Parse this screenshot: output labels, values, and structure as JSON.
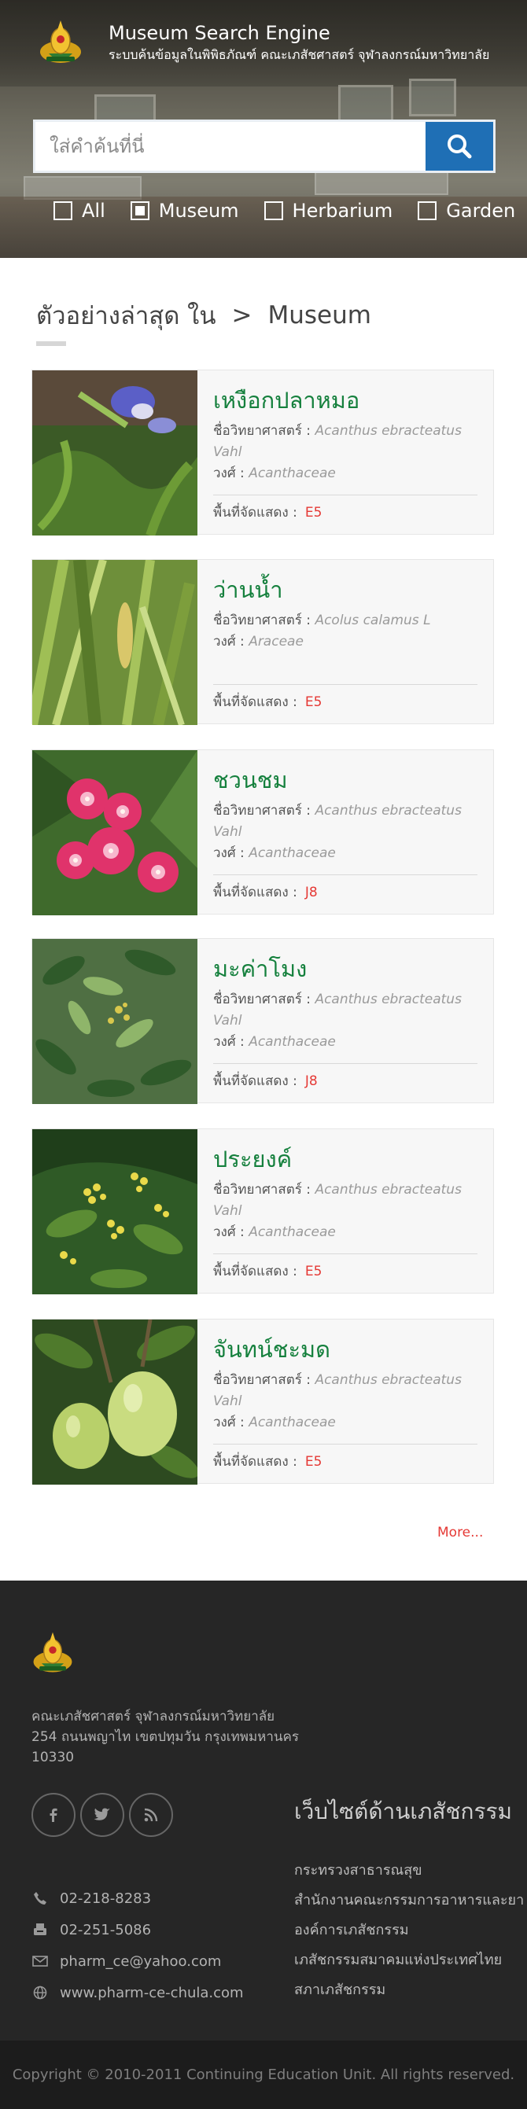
{
  "header": {
    "title": "Museum Search Engine",
    "subtitle": "ระบบค้นข้อมูลในพิพิธภัณฑ์ คณะเภสัชศาสตร์ จุฬาลงกรณ์มหาวิทยาลัย"
  },
  "search": {
    "placeholder": "ใส่คำค้นที่นี่",
    "value": "",
    "button_icon": "search-icon",
    "accent": "#1f6fb5"
  },
  "filters": [
    {
      "label": "All",
      "checked": false
    },
    {
      "label": "Museum",
      "checked": true
    },
    {
      "label": "Herbarium",
      "checked": false
    },
    {
      "label": "Garden",
      "checked": false
    }
  ],
  "section": {
    "heading": "ตัวอย่างล่าสุด ใน",
    "separator": ">",
    "category": "Museum"
  },
  "labels": {
    "sci_name": "ชื่อวิทยาศาสตร์ :",
    "family": "วงศ์ :",
    "area": "พื้นที่จัดแสดง :"
  },
  "items": [
    {
      "name": "เหงือกปลาหมอ",
      "sci_name": "Acanthus ebracteatus Vahl",
      "family": "Acanthaceae",
      "area": "E5",
      "image": "purple-flower-photo"
    },
    {
      "name": "ว่านน้ำ",
      "sci_name": "Acolus calamus L",
      "family": "Araceae",
      "area": "E5",
      "image": "sweet-flag-photo"
    },
    {
      "name": "ชวนชม",
      "sci_name": "Acanthus ebracteatus Vahl",
      "family": "Acanthaceae",
      "area": "J8",
      "image": "pink-flower-photo"
    },
    {
      "name": "มะค่าโมง",
      "sci_name": "Acanthus ebracteatus Vahl",
      "family": "Acanthaceae",
      "area": "J8",
      "image": "leafy-branch-photo"
    },
    {
      "name": "ประยงค์",
      "sci_name": "Acanthus ebracteatus Vahl",
      "family": "Acanthaceae",
      "area": "E5",
      "image": "yellow-blossom-photo"
    },
    {
      "name": "จันทน์ชะมด",
      "sci_name": "Acanthus ebracteatus Vahl",
      "family": "Acanthaceae",
      "area": "E5",
      "image": "green-fruit-photo"
    }
  ],
  "more_link": "More...",
  "footer": {
    "address_line1": "คณะเภสัชศาสตร์ จุฬาลงกรณ์มหาวิทยาลัย",
    "address_line2": "254 ถนนพญาไท เขตปทุมวัน กรุงเทพมหานคร",
    "address_line3": "10330",
    "social": [
      "facebook-icon",
      "twitter-icon",
      "rss-icon"
    ],
    "contacts": [
      {
        "icon": "phone-icon",
        "text": "02-218-8283"
      },
      {
        "icon": "fax-icon",
        "text": "02-251-5086"
      },
      {
        "icon": "mail-icon",
        "text": "pharm_ce@yahoo.com"
      },
      {
        "icon": "globe-icon",
        "text": "www.pharm-ce-chula.com"
      }
    ],
    "links_title": "เว็บไซต์ด้านเภสัชกรรม",
    "links": [
      "กระทรวงสาธารณสุข",
      "สำนักงานคณะกรรมการอาหารและยา",
      "องค์การเภสัชกรรม",
      "เภสัชกรรมสมาคมแห่งประเทศไทย",
      "สภาเภสัชกรรม"
    ],
    "copyright": "Copyright © 2010-2011 Continuing Education Unit. All rights reserved."
  }
}
